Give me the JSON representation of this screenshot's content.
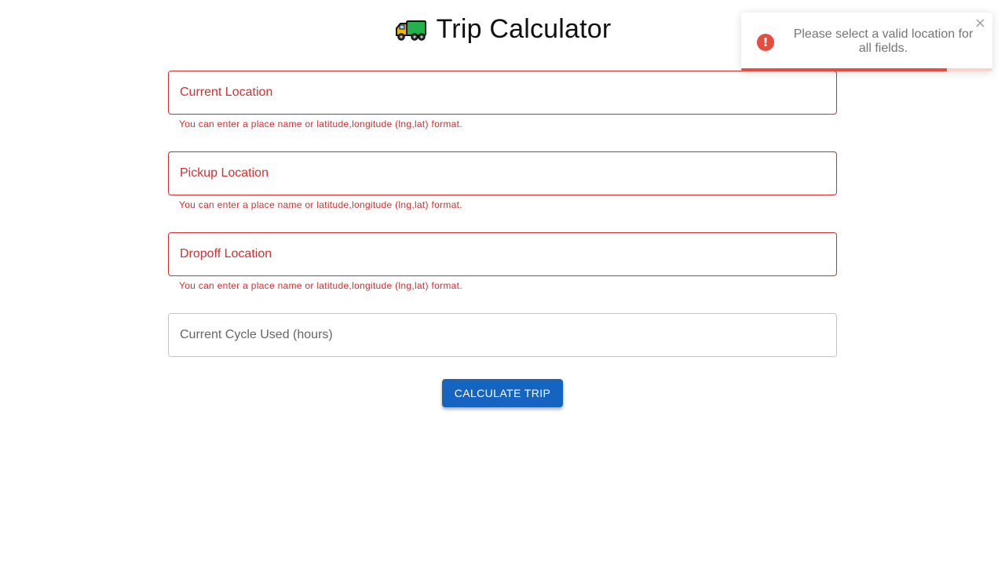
{
  "header": {
    "icon": "delivery-truck-icon",
    "title": "Trip Calculator"
  },
  "form": {
    "current_location": {
      "label": "Current Location",
      "value": "",
      "helper": "You can enter a place name or latitude,longitude (lng,lat) format."
    },
    "pickup_location": {
      "label": "Pickup Location",
      "value": "",
      "helper": "You can enter a place name or latitude,longitude (lng,lat) format."
    },
    "dropoff_location": {
      "label": "Dropoff Location",
      "value": "",
      "helper": "You can enter a place name or latitude,longitude (lng,lat) format."
    },
    "cycle_used": {
      "label": "Current Cycle Used (hours)",
      "value": ""
    },
    "submit_label": "CALCULATE TRIP"
  },
  "toast": {
    "type": "error",
    "icon": "error-exclamation-icon",
    "icon_glyph": "!",
    "message": "Please select a valid location for all fields.",
    "close_glyph": "×",
    "progress_remaining": 0.82
  },
  "colors": {
    "error": "#d32f2f",
    "primary_button": "#1565c0",
    "toast_error": "#e74c3c",
    "truck_cab": "#f2b600",
    "truck_body": "#22b14c"
  }
}
